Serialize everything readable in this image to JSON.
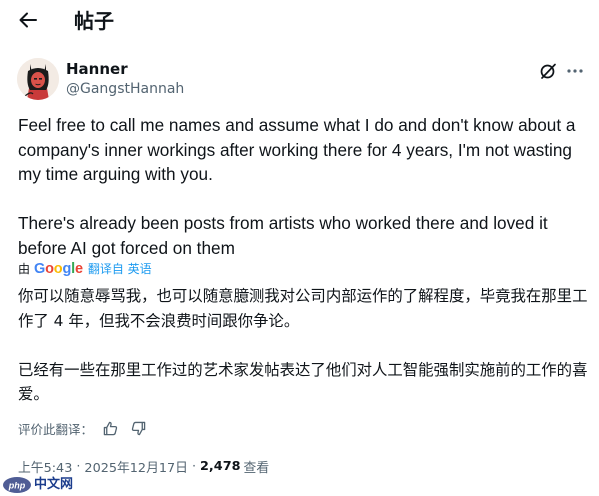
{
  "header": {
    "title": "帖子"
  },
  "author": {
    "name": "Hanner",
    "handle": "@GangstHannah"
  },
  "post": {
    "paragraphs": [
      "Feel free to call me names and assume what I do and don't know about a company's inner workings after working there for 4 years, I'm not wasting my time arguing with you.",
      "There's already been posts from artists who worked there and loved it before AI got forced on them"
    ]
  },
  "translation": {
    "by": "由",
    "provider": "Google",
    "link": "翻译自 英语",
    "paragraphs": [
      "你可以随意辱骂我，也可以随意臆测我对公司内部运作的了解程度，毕竟我在那里工作了 4 年，但我不会浪费时间跟你争论。",
      "已经有一些在那里工作过的艺术家发帖表达了他们对人工智能强制实施前的工作的喜爱。"
    ],
    "rate_label": "评价此翻译："
  },
  "meta": {
    "time": "上午5:43",
    "separator": "·",
    "date": "2025年12月17日",
    "views_count": "2,478",
    "views_label": "查看"
  },
  "watermark": {
    "text": "中文网"
  },
  "colors": {
    "accent": "#1d9bf0",
    "secondary_text": "#536471",
    "primary_text": "#0f1419"
  },
  "icons": [
    "back-arrow-icon",
    "grok-icon",
    "more-icon",
    "thumbs-up-icon",
    "thumbs-down-icon",
    "php-logo-icon"
  ]
}
